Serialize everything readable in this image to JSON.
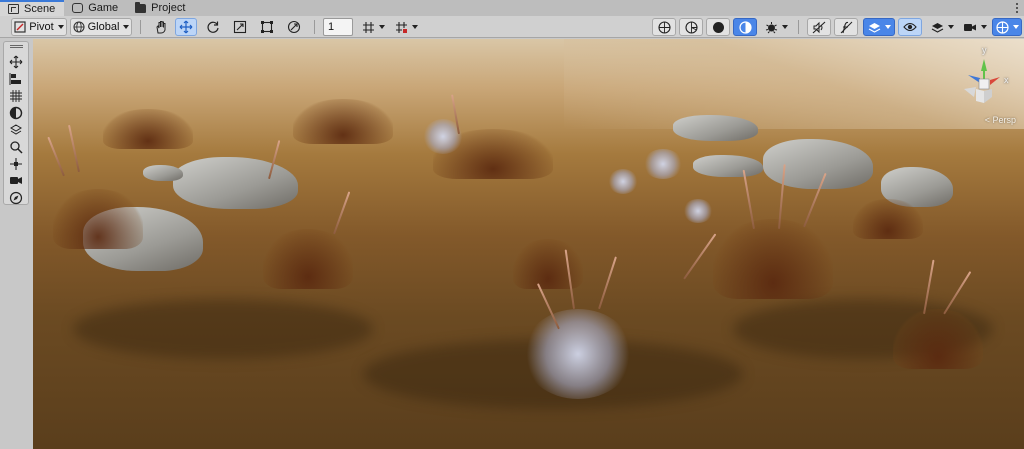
{
  "tabs": [
    {
      "label": "Scene",
      "icon": "scene-icon",
      "active": true
    },
    {
      "label": "Game",
      "icon": "game-icon",
      "active": false
    },
    {
      "label": "Project",
      "icon": "folder-icon",
      "active": false
    }
  ],
  "toolbar": {
    "pivot_label": "Pivot",
    "global_label": "Global",
    "grid_size_value": "1",
    "left_tools": [
      "hand-tool-icon",
      "move-tool-icon",
      "rotate-tool-icon",
      "scale-tool-icon",
      "rect-tool-icon",
      "transform-tool-icon"
    ],
    "right_tools": [
      "draw-mode-icon",
      "shading-icon",
      "lighting-icon",
      "effects-icon",
      "audio-icon",
      "fx-icon",
      "visibility-icon",
      "layers-icon",
      "camera-icon",
      "gizmos-icon"
    ]
  },
  "tool_strip": {
    "items": [
      "move-icon",
      "align-icon",
      "grid-icon",
      "sphere-icon",
      "layers-icon",
      "search-icon",
      "transform-icon",
      "camera-icon",
      "compass-icon"
    ]
  },
  "viewport": {
    "gizmo_y_label": "y",
    "gizmo_x_label": "x",
    "projection_label": "< Persp"
  },
  "colors": {
    "accent": "#3a79d8",
    "selected_tool": "#bcd5f7",
    "active_toggle": "#4a86e8"
  }
}
